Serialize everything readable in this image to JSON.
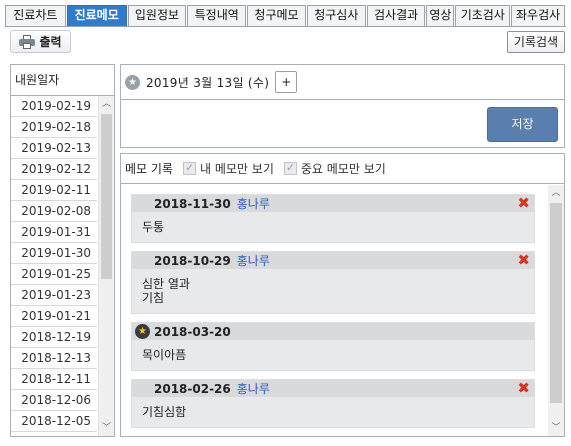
{
  "tabs": [
    {
      "label": "진료차트",
      "active": false
    },
    {
      "label": "진료메모",
      "active": true
    },
    {
      "label": "입원정보",
      "active": false
    },
    {
      "label": "특정내역",
      "active": false
    },
    {
      "label": "청구메모",
      "active": false
    },
    {
      "label": "청구심사",
      "active": false
    },
    {
      "label": "검사결과",
      "active": false
    },
    {
      "label": "영상",
      "active": false
    },
    {
      "label": "기초검사",
      "active": false
    },
    {
      "label": "좌우검사",
      "active": false
    }
  ],
  "toolbar": {
    "print_label": "출력",
    "record_search_label": "기록검색"
  },
  "left": {
    "header": "내원일자",
    "dates": [
      "2019-02-19",
      "2019-02-18",
      "2019-02-13",
      "2019-02-12",
      "2019-02-11",
      "2019-02-08",
      "2019-01-31",
      "2019-01-30",
      "2019-01-25",
      "2019-01-23",
      "2019-01-21",
      "2018-12-19",
      "2018-12-13",
      "2018-12-11",
      "2018-12-06",
      "2018-12-05"
    ]
  },
  "datebar": {
    "date_text": "2019년 3월 13일 (수)",
    "plus_label": "+"
  },
  "memo_input": {
    "save_label": "저장"
  },
  "memo_panel": {
    "title": "메모 기록",
    "only_mine_label": "내 메모만 보기",
    "important_only_label": "중요 메모만 보기",
    "records": [
      {
        "date": "2018-11-30",
        "author": "홍나루",
        "body": "두통",
        "important": false,
        "deletable": true
      },
      {
        "date": "2018-10-29",
        "author": "홍나루",
        "body": "심한 열과\n기침",
        "important": false,
        "deletable": true
      },
      {
        "date": "2018-03-20",
        "author": "",
        "body": "목이아픔",
        "important": true,
        "deletable": false
      },
      {
        "date": "2018-02-26",
        "author": "홍나루",
        "body": "기침심함",
        "important": false,
        "deletable": true
      }
    ]
  }
}
